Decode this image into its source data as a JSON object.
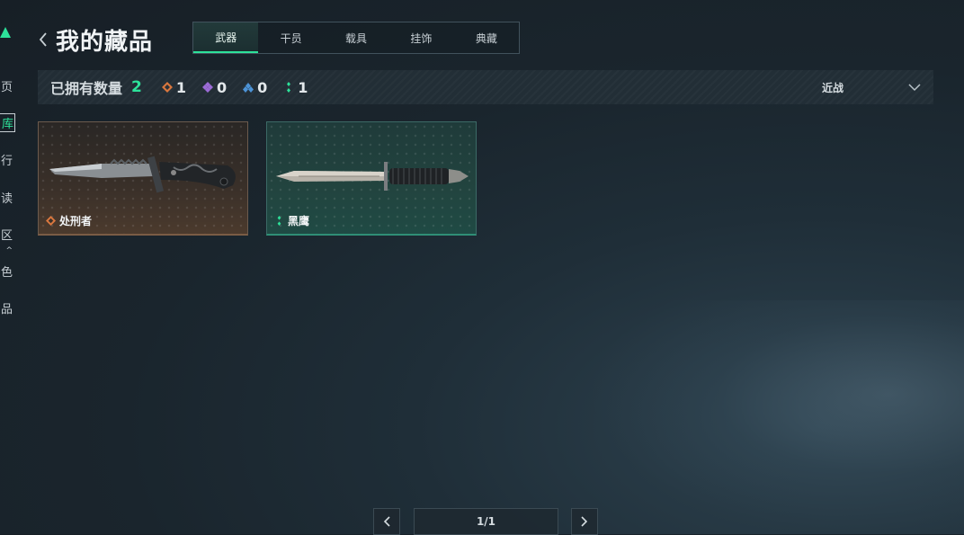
{
  "sidebar": {
    "items": [
      {
        "label": "页",
        "active": false
      },
      {
        "label": "库",
        "active": true
      },
      {
        "label": "行",
        "active": false
      },
      {
        "label": "读",
        "active": false
      },
      {
        "label": "区",
        "active": false
      },
      {
        "label": "色",
        "active": false
      },
      {
        "label": "品",
        "active": false
      }
    ],
    "accent": "#2de29a"
  },
  "header": {
    "title": "我的藏品",
    "tabs": [
      {
        "label": "武器",
        "active": true
      },
      {
        "label": "干员",
        "active": false
      },
      {
        "label": "载具",
        "active": false
      },
      {
        "label": "挂饰",
        "active": false
      },
      {
        "label": "典藏",
        "active": false
      }
    ]
  },
  "stats": {
    "owned_label": "已拥有数量",
    "owned_count": "2",
    "rarities": [
      {
        "icon": "orange-diamond-icon",
        "color": "#d9773e",
        "count": "1"
      },
      {
        "icon": "purple-diamond-icon",
        "color": "#9b6bd6",
        "count": "0"
      },
      {
        "icon": "blue-chevron-icon",
        "color": "#4c93d6",
        "count": "0"
      },
      {
        "icon": "green-dots-icon",
        "color": "#2de29a",
        "count": "1"
      }
    ],
    "filter": {
      "label": "近战"
    }
  },
  "items": [
    {
      "name": "处刑者",
      "rarity_color": "#d9773e",
      "icon": "combat-knife-icon"
    },
    {
      "name": "黑鹰",
      "rarity_color": "#2de29a",
      "icon": "dagger-knife-icon"
    }
  ],
  "pagination": {
    "label": "1/1"
  }
}
